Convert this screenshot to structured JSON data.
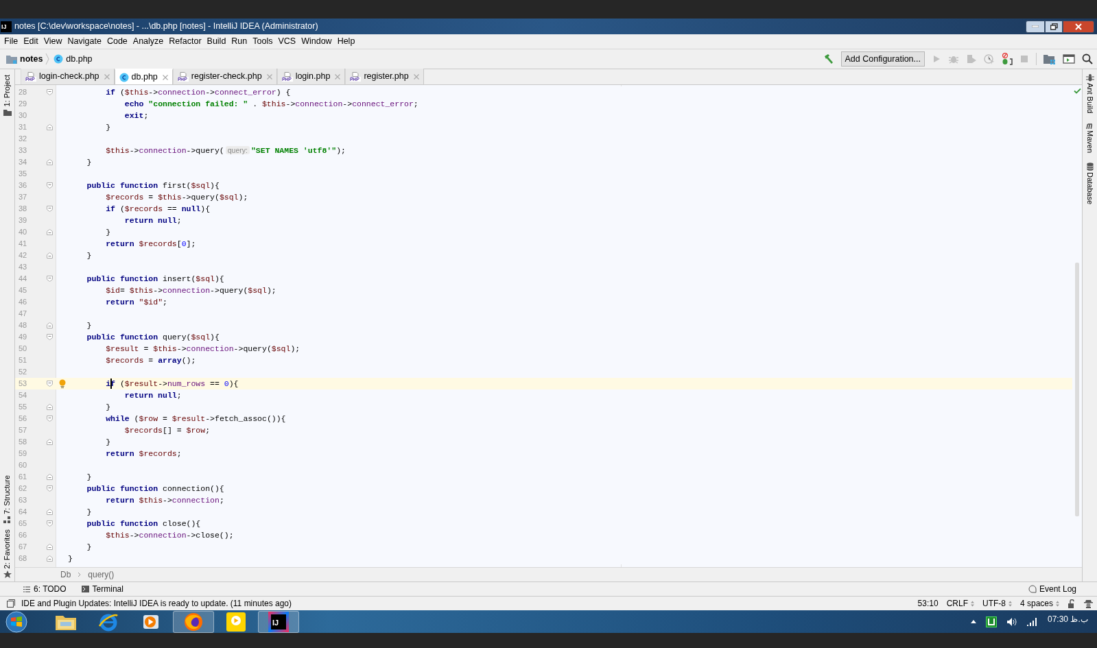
{
  "window": {
    "title": "notes [C:\\dev\\workspace\\notes] - ...\\db.php [notes] - IntelliJ IDEA (Administrator)",
    "logo": "IJ"
  },
  "menu": [
    "File",
    "Edit",
    "View",
    "Navigate",
    "Code",
    "Analyze",
    "Refactor",
    "Build",
    "Run",
    "Tools",
    "VCS",
    "Window",
    "Help"
  ],
  "navbar": {
    "breadcrumbs": [
      {
        "kind": "folder",
        "label": "notes"
      },
      {
        "kind": "class",
        "label": "db.php"
      }
    ],
    "run_config": "Add Configuration..."
  },
  "tabs": [
    {
      "label": "login-check.php",
      "kind": "php",
      "selected": false
    },
    {
      "label": "db.php",
      "kind": "class",
      "selected": true
    },
    {
      "label": "register-check.php",
      "kind": "php",
      "selected": false
    },
    {
      "label": "login.php",
      "kind": "php",
      "selected": false
    },
    {
      "label": "register.php",
      "kind": "php",
      "selected": false
    }
  ],
  "left_toolbar": {
    "top": [
      "1: Project"
    ],
    "bottom": [
      "7: Structure",
      "2: Favorites"
    ]
  },
  "right_toolbar": [
    "Ant Build",
    "Maven",
    "Database"
  ],
  "editor": {
    "lines": [
      {
        "number": "28",
        "kind": "opener",
        "current": false,
        "tokens": [
          {
            "kind": "keyword",
            "text": "        if"
          },
          {
            "kind": "plain",
            "text": " ("
          },
          {
            "kind": "var",
            "text": "$this"
          },
          {
            "kind": "plain",
            "text": "->"
          },
          {
            "kind": "field",
            "text": "connection"
          },
          {
            "kind": "plain",
            "text": "->"
          },
          {
            "kind": "field",
            "text": "connect_error"
          },
          {
            "kind": "plain",
            "text": ") {"
          }
        ]
      },
      {
        "number": "29",
        "kind": "plain",
        "current": false,
        "tokens": [
          {
            "kind": "keyword",
            "text": "            echo"
          },
          {
            "kind": "string",
            "text": " \"connection failed: \""
          },
          {
            "kind": "plain",
            "text": " . "
          },
          {
            "kind": "var",
            "text": "$this"
          },
          {
            "kind": "plain",
            "text": "->"
          },
          {
            "kind": "field",
            "text": "connection"
          },
          {
            "kind": "plain",
            "text": "->"
          },
          {
            "kind": "field",
            "text": "connect_error"
          },
          {
            "kind": "plain",
            "text": ";"
          }
        ]
      },
      {
        "number": "30",
        "kind": "plain",
        "current": false,
        "tokens": [
          {
            "kind": "keyword",
            "text": "            exit"
          },
          {
            "kind": "plain",
            "text": ";"
          }
        ]
      },
      {
        "number": "31",
        "kind": "closer",
        "current": false,
        "tokens": [
          {
            "kind": "plain",
            "text": "        }"
          }
        ]
      },
      {
        "number": "32",
        "kind": "plain",
        "current": false
      },
      {
        "number": "33",
        "kind": "plain",
        "current": false,
        "tokens": [
          {
            "kind": "var",
            "text": "        $this"
          },
          {
            "kind": "plain",
            "text": "->"
          },
          {
            "kind": "field",
            "text": "connection"
          },
          {
            "kind": "plain",
            "text": "->query("
          },
          {
            "kind": "hint",
            "text": "query:"
          },
          {
            "kind": "string",
            "text": "\"SET NAMES 'utf8'\""
          },
          {
            "kind": "plain",
            "text": ");"
          }
        ]
      },
      {
        "number": "34",
        "kind": "closer",
        "current": false,
        "tokens": [
          {
            "kind": "plain",
            "text": "    }"
          }
        ]
      },
      {
        "number": "35",
        "kind": "plain",
        "current": false
      },
      {
        "number": "36",
        "kind": "opener",
        "current": false,
        "tokens": [
          {
            "kind": "keyword",
            "text": "    public function"
          },
          {
            "kind": "plain",
            "text": " first("
          },
          {
            "kind": "var",
            "text": "$sql"
          },
          {
            "kind": "plain",
            "text": "){"
          }
        ]
      },
      {
        "number": "37",
        "kind": "plain",
        "current": false,
        "tokens": [
          {
            "kind": "var",
            "text": "        $records"
          },
          {
            "kind": "plain",
            "text": " = "
          },
          {
            "kind": "var",
            "text": "$this"
          },
          {
            "kind": "plain",
            "text": "->query("
          },
          {
            "kind": "var",
            "text": "$sql"
          },
          {
            "kind": "plain",
            "text": ");"
          }
        ]
      },
      {
        "number": "38",
        "kind": "opener",
        "current": false,
        "tokens": [
          {
            "kind": "keyword",
            "text": "        if"
          },
          {
            "kind": "plain",
            "text": " ("
          },
          {
            "kind": "var",
            "text": "$records"
          },
          {
            "kind": "plain",
            "text": " == "
          },
          {
            "kind": "keyword",
            "text": "null"
          },
          {
            "kind": "plain",
            "text": "){"
          }
        ]
      },
      {
        "number": "39",
        "kind": "plain",
        "current": false,
        "tokens": [
          {
            "kind": "keyword",
            "text": "            return null"
          },
          {
            "kind": "plain",
            "text": ";"
          }
        ]
      },
      {
        "number": "40",
        "kind": "closer",
        "current": false,
        "tokens": [
          {
            "kind": "plain",
            "text": "        }"
          }
        ]
      },
      {
        "number": "41",
        "kind": "plain",
        "current": false,
        "tokens": [
          {
            "kind": "keyword",
            "text": "        return"
          },
          {
            "kind": "var",
            "text": " $records"
          },
          {
            "kind": "plain",
            "text": "["
          },
          {
            "kind": "number",
            "text": "0"
          },
          {
            "kind": "plain",
            "text": "];"
          }
        ]
      },
      {
        "number": "42",
        "kind": "closer",
        "current": false,
        "tokens": [
          {
            "kind": "plain",
            "text": "    }"
          }
        ]
      },
      {
        "number": "43",
        "kind": "plain",
        "current": false
      },
      {
        "number": "44",
        "kind": "opener",
        "current": false,
        "tokens": [
          {
            "kind": "keyword",
            "text": "    public function"
          },
          {
            "kind": "plain",
            "text": " insert("
          },
          {
            "kind": "var",
            "text": "$sql"
          },
          {
            "kind": "plain",
            "text": "){"
          }
        ]
      },
      {
        "number": "45",
        "kind": "plain",
        "current": false,
        "tokens": [
          {
            "kind": "var",
            "text": "        $id"
          },
          {
            "kind": "plain",
            "text": "= "
          },
          {
            "kind": "var",
            "text": "$this"
          },
          {
            "kind": "plain",
            "text": "->"
          },
          {
            "kind": "field",
            "text": "connection"
          },
          {
            "kind": "plain",
            "text": "->query("
          },
          {
            "kind": "var",
            "text": "$sql"
          },
          {
            "kind": "plain",
            "text": ");"
          }
        ]
      },
      {
        "number": "46",
        "kind": "plain",
        "current": false,
        "tokens": [
          {
            "kind": "keyword",
            "text": "        return"
          },
          {
            "kind": "var",
            "text": " \"$id\""
          },
          {
            "kind": "plain",
            "text": ";"
          }
        ]
      },
      {
        "number": "47",
        "kind": "plain",
        "current": false
      },
      {
        "number": "48",
        "kind": "closer",
        "current": false,
        "tokens": [
          {
            "kind": "plain",
            "text": "    }"
          }
        ]
      },
      {
        "number": "49",
        "kind": "opener",
        "current": false,
        "tokens": [
          {
            "kind": "keyword",
            "text": "    public function"
          },
          {
            "kind": "plain",
            "text": " query("
          },
          {
            "kind": "var",
            "text": "$sql"
          },
          {
            "kind": "plain",
            "text": "){"
          }
        ]
      },
      {
        "number": "50",
        "kind": "plain",
        "current": false,
        "tokens": [
          {
            "kind": "var",
            "text": "        $result"
          },
          {
            "kind": "plain",
            "text": " = "
          },
          {
            "kind": "var",
            "text": "$this"
          },
          {
            "kind": "plain",
            "text": "->"
          },
          {
            "kind": "field",
            "text": "connection"
          },
          {
            "kind": "plain",
            "text": "->query("
          },
          {
            "kind": "var",
            "text": "$sql"
          },
          {
            "kind": "plain",
            "text": ");"
          }
        ]
      },
      {
        "number": "51",
        "kind": "plain",
        "current": false,
        "tokens": [
          {
            "kind": "var",
            "text": "        $records"
          },
          {
            "kind": "plain",
            "text": " = "
          },
          {
            "kind": "keyword",
            "text": "array"
          },
          {
            "kind": "plain",
            "text": "();"
          }
        ]
      },
      {
        "number": "52",
        "kind": "plain",
        "current": false
      },
      {
        "number": "53",
        "kind": "opener",
        "current": true,
        "tokens": [
          {
            "kind": "keyword",
            "text": "        if"
          },
          {
            "kind": "plain",
            "text": " ("
          },
          {
            "kind": "var",
            "text": "$result"
          },
          {
            "kind": "plain",
            "text": "->"
          },
          {
            "kind": "field",
            "text": "num_rows"
          },
          {
            "kind": "plain",
            "text": " == "
          },
          {
            "kind": "number",
            "text": "0"
          },
          {
            "kind": "plain",
            "text": "){"
          }
        ]
      },
      {
        "number": "54",
        "kind": "plain",
        "current": false,
        "tokens": [
          {
            "kind": "keyword",
            "text": "            return null"
          },
          {
            "kind": "plain",
            "text": ";"
          }
        ]
      },
      {
        "number": "55",
        "kind": "closer",
        "current": false,
        "tokens": [
          {
            "kind": "plain",
            "text": "        }"
          }
        ]
      },
      {
        "number": "56",
        "kind": "opener",
        "current": false,
        "tokens": [
          {
            "kind": "keyword",
            "text": "        while"
          },
          {
            "kind": "plain",
            "text": " ("
          },
          {
            "kind": "var",
            "text": "$row"
          },
          {
            "kind": "plain",
            "text": " = "
          },
          {
            "kind": "var",
            "text": "$result"
          },
          {
            "kind": "plain",
            "text": "->fetch_assoc()){"
          }
        ]
      },
      {
        "number": "57",
        "kind": "plain",
        "current": false,
        "tokens": [
          {
            "kind": "var",
            "text": "            $records"
          },
          {
            "kind": "plain",
            "text": "[] = "
          },
          {
            "kind": "var",
            "text": "$row"
          },
          {
            "kind": "plain",
            "text": ";"
          }
        ]
      },
      {
        "number": "58",
        "kind": "closer",
        "current": false,
        "tokens": [
          {
            "kind": "plain",
            "text": "        }"
          }
        ]
      },
      {
        "number": "59",
        "kind": "plain",
        "current": false,
        "tokens": [
          {
            "kind": "keyword",
            "text": "        return"
          },
          {
            "kind": "var",
            "text": " $records"
          },
          {
            "kind": "plain",
            "text": ";"
          }
        ]
      },
      {
        "number": "60",
        "kind": "plain",
        "current": false
      },
      {
        "number": "61",
        "kind": "closer",
        "current": false,
        "tokens": [
          {
            "kind": "plain",
            "text": "    }"
          }
        ]
      },
      {
        "number": "62",
        "kind": "opener",
        "current": false,
        "tokens": [
          {
            "kind": "keyword",
            "text": "    public function"
          },
          {
            "kind": "plain",
            "text": " connection(){"
          }
        ]
      },
      {
        "number": "63",
        "kind": "plain",
        "current": false,
        "tokens": [
          {
            "kind": "keyword",
            "text": "        return"
          },
          {
            "kind": "var",
            "text": " $this"
          },
          {
            "kind": "plain",
            "text": "->"
          },
          {
            "kind": "field",
            "text": "connection"
          },
          {
            "kind": "plain",
            "text": ";"
          }
        ]
      },
      {
        "number": "64",
        "kind": "closer",
        "current": false,
        "tokens": [
          {
            "kind": "plain",
            "text": "    }"
          }
        ]
      },
      {
        "number": "65",
        "kind": "opener",
        "current": false,
        "tokens": [
          {
            "kind": "keyword",
            "text": "    public function"
          },
          {
            "kind": "plain",
            "text": " close(){"
          }
        ]
      },
      {
        "number": "66",
        "kind": "plain",
        "current": false,
        "tokens": [
          {
            "kind": "var",
            "text": "        $this"
          },
          {
            "kind": "plain",
            "text": "->"
          },
          {
            "kind": "field",
            "text": "connection"
          },
          {
            "kind": "plain",
            "text": "->close();"
          }
        ]
      },
      {
        "number": "67",
        "kind": "closer",
        "current": false,
        "tokens": [
          {
            "kind": "plain",
            "text": "    }"
          }
        ]
      },
      {
        "number": "68",
        "kind": "closer",
        "current": false,
        "tokens": [
          {
            "kind": "plain",
            "text": "}"
          }
        ]
      }
    ]
  },
  "breadcrumb": [
    "Db",
    "query()"
  ],
  "tool_buttons": [
    {
      "kind": "todo",
      "label": "6: TODO"
    },
    {
      "kind": "terminal",
      "label": "Terminal"
    }
  ],
  "event_log": "Event Log",
  "status_bar": {
    "message": "IDE and Plugin Updates: IntelliJ IDEA is ready to update. (11 minutes ago)",
    "position": "53:10",
    "line_separator": "CRLF",
    "encoding": "UTF-8",
    "indent": "4 spaces"
  },
  "taskbar": {
    "apps": [
      {
        "kind": "explorer",
        "selected": false
      },
      {
        "kind": "browser",
        "selected": false
      },
      {
        "kind": "media",
        "selected": false
      },
      {
        "kind": "firefox",
        "selected": true
      },
      {
        "kind": "player",
        "selected": false
      },
      {
        "kind": "intellij",
        "selected": true,
        "logo": "IJ"
      }
    ],
    "clock": "07:30 ب.ظ"
  }
}
